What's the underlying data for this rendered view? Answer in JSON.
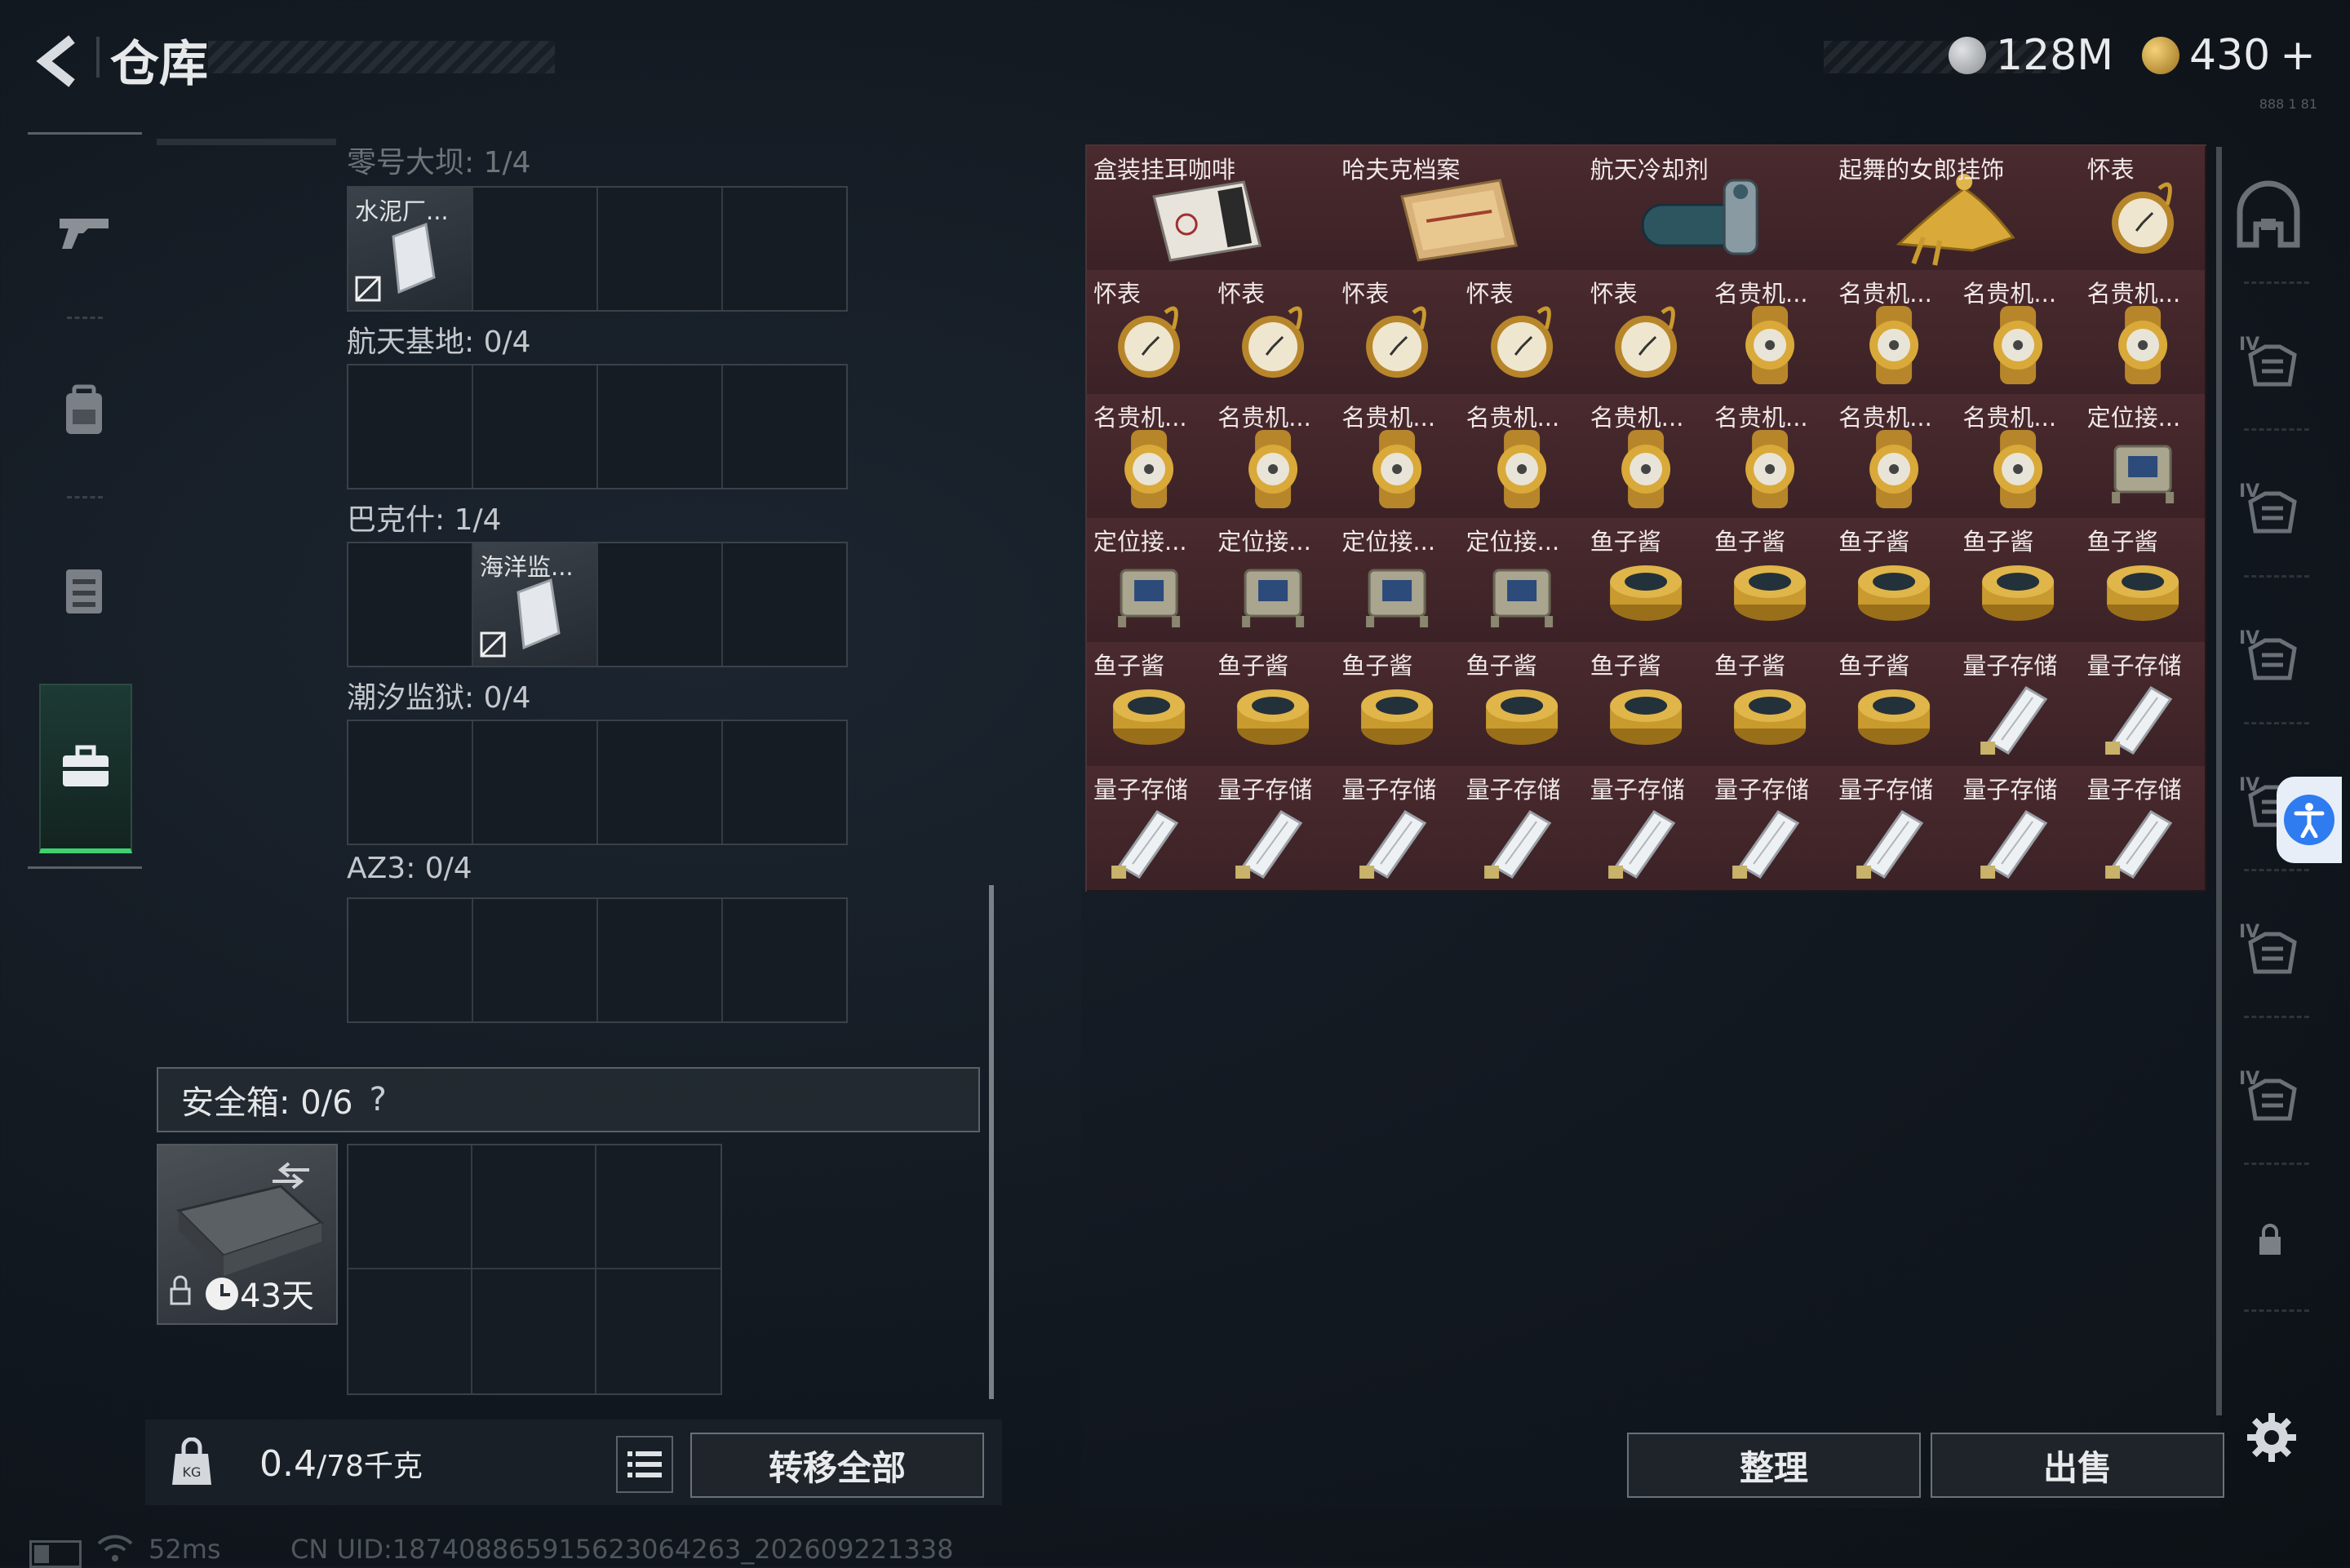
{
  "header": {
    "title": "仓库",
    "currency1": "128M",
    "currency2": "430",
    "currency2_plus": "+",
    "small_text": "888 1 81"
  },
  "left_rail": {
    "items": [
      {
        "icon": "pistol-icon"
      },
      {
        "icon": "backpack-icon"
      },
      {
        "icon": "vest-icon"
      },
      {
        "icon": "briefcase-icon",
        "active": true
      }
    ]
  },
  "sections": [
    {
      "label": "零号大坝: 1/4",
      "slots": [
        {
          "name": "水泥厂..."
        },
        null,
        null,
        null
      ]
    },
    {
      "label": "航天基地: 0/4",
      "slots": [
        null,
        null,
        null,
        null
      ]
    },
    {
      "label": "巴克什: 1/4",
      "slots": [
        null,
        {
          "name": "海洋监..."
        },
        null,
        null
      ]
    },
    {
      "label": "潮汐监狱: 0/4",
      "slots": [
        null,
        null,
        null,
        null
      ]
    },
    {
      "label": "AZ3: 0/4",
      "slots": [
        null,
        null,
        null,
        null
      ]
    }
  ],
  "safebox": {
    "label": "安全箱:  0/6",
    "help": "?",
    "days": "43天"
  },
  "bottom": {
    "weight_value": "0.4",
    "weight_cap": "/78千克",
    "transfer_all": "转移全部",
    "sort": "整理",
    "sell": "出售"
  },
  "status": {
    "ping": "52ms",
    "uid": "CN UID:1874088659156230642​63_202609221338"
  },
  "inventory": {
    "row0": [
      {
        "label": "盒装挂耳咖啡",
        "kind": "coffee",
        "span": 2
      },
      {
        "label": "哈夫克档案",
        "kind": "archive",
        "span": 2
      },
      {
        "label": "航天冷却剂",
        "kind": "coolant",
        "span": 2
      },
      {
        "label": "起舞的女郎挂饰",
        "kind": "statue",
        "span": 2
      },
      {
        "label": "怀表",
        "kind": "pocketwatch",
        "span": 1
      }
    ],
    "rows": [
      [
        "怀表",
        "怀表",
        "怀表",
        "怀表",
        "怀表",
        "名贵机...",
        "名贵机...",
        "名贵机...",
        "名贵机..."
      ],
      [
        "名贵机...",
        "名贵机...",
        "名贵机...",
        "名贵机...",
        "名贵机...",
        "名贵机...",
        "名贵机...",
        "名贵机...",
        "定位接..."
      ],
      [
        "定位接...",
        "定位接...",
        "定位接...",
        "定位接...",
        "鱼子酱",
        "鱼子酱",
        "鱼子酱",
        "鱼子酱",
        "鱼子酱"
      ],
      [
        "鱼子酱",
        "鱼子酱",
        "鱼子酱",
        "鱼子酱",
        "鱼子酱",
        "鱼子酱",
        "鱼子酱",
        "量子存储",
        "量子存储"
      ],
      [
        "量子存储",
        "量子存储",
        "量子存储",
        "量子存储",
        "量子存储",
        "量子存储",
        "量子存储",
        "量子存储",
        "量子存储"
      ]
    ]
  },
  "right_rail": {
    "items": [
      "helmet-icon",
      "armor-iv-icon",
      "armor-iv-icon",
      "armor-iv-icon",
      "armor-iv-icon",
      "armor-iv-icon",
      "armor-iv-icon",
      "lock-icon"
    ]
  },
  "colors": {
    "accent_green": "#3ed16f",
    "grid_bg": "#3b2226",
    "gold": "#c99a2e"
  }
}
